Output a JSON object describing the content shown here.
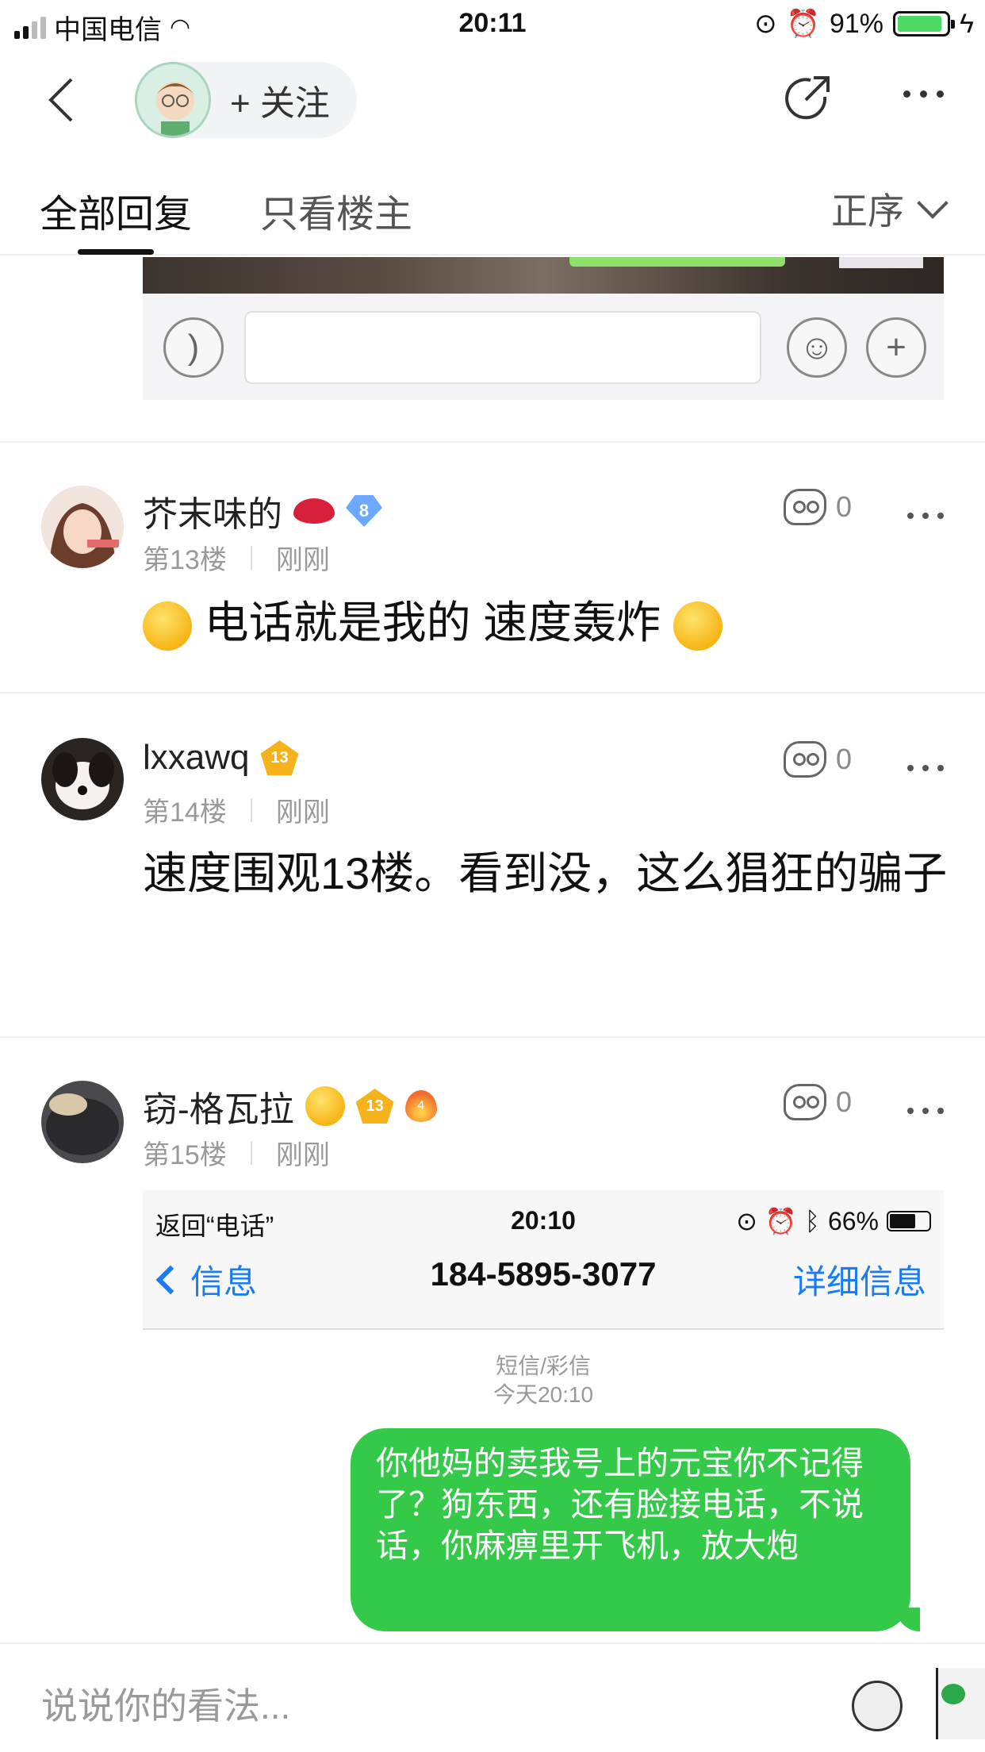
{
  "status_bar": {
    "carrier": "中国电信",
    "time": "20:11",
    "battery": "91%"
  },
  "nav": {
    "follow_label": "+ 关注"
  },
  "tabs": {
    "all": "全部回复",
    "op_only": "只看楼主",
    "sort": "正序"
  },
  "posts": [
    {
      "username": "芥末味的",
      "level": "8",
      "floor": "第13楼",
      "time": "刚刚",
      "likes": "0",
      "content": "电话就是我的 速度轰炸"
    },
    {
      "username": "lxxawq",
      "level": "13",
      "floor": "第14楼",
      "time": "刚刚",
      "likes": "0",
      "content": "速度围观13楼。看到没，这么猖狂的骗子"
    },
    {
      "username": "窃-格瓦拉",
      "level": "13",
      "level2": "4",
      "floor": "第15楼",
      "time": "刚刚",
      "likes": "0"
    }
  ],
  "screenshot": {
    "back_label": "返回“电话”",
    "time": "20:10",
    "battery": "66%",
    "back_nav": "信息",
    "phone_number": "184-5895-3077",
    "detail": "详细信息",
    "msg_type": "短信/彩信",
    "msg_time": "今天20:10",
    "message": "你他妈的卖我号上的元宝你不记得了？狗东西，还有脸接电话，不说话，你麻痹里开飞机，放大炮"
  },
  "bottom": {
    "placeholder": "说说你的看法..."
  },
  "colors": {
    "accent_blue": "#1a7cf5",
    "bubble_green": "#35c94a",
    "battery_green": "#4cd964"
  }
}
